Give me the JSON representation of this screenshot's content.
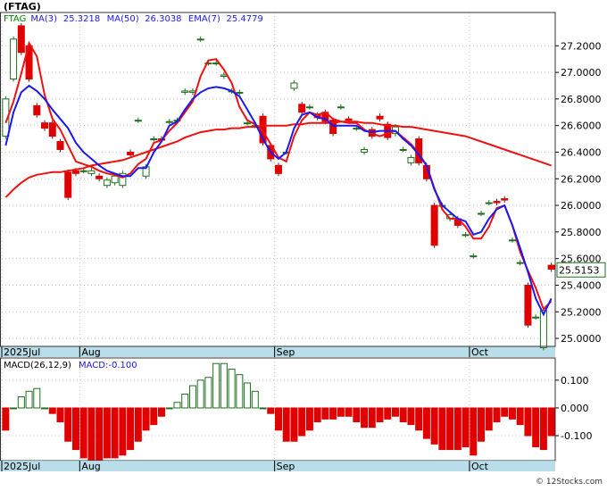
{
  "title": "(FTAG)",
  "watermark": "© 12Stocks.com",
  "colors": {
    "up": "#1f6f1f",
    "down": "#e00000",
    "ma3": "#ee1111",
    "ma50": "#ee1111",
    "ema7": "#1a1aee",
    "ma_fast": "#1a1aee",
    "price_box": "#1f6f1f",
    "frame": "#333333"
  },
  "chart_data": [
    {
      "type": "candlestick",
      "legend": [
        {
          "text": "FTAG",
          "color": "#008000"
        },
        {
          "text": "MA(3)",
          "color": "#1a1aee"
        },
        {
          "text": "25.3218",
          "color": "#1a1aee"
        },
        {
          "text": "MA(50)",
          "color": "#1a1aee"
        },
        {
          "text": "26.3038",
          "color": "#1a1aee"
        },
        {
          "text": "EMA(7)",
          "color": "#1a1aee"
        },
        {
          "text": "25.4779",
          "color": "#1a1aee"
        }
      ],
      "last_price": "25.5153",
      "ylim": [
        24.94,
        27.45
      ],
      "y_ticks": [
        "25.0000",
        "25.2000",
        "25.4000",
        "25.6000",
        "25.8000",
        "26.0000",
        "26.2000",
        "26.4000",
        "26.6000",
        "26.8000",
        "27.0000",
        "27.2000"
      ],
      "x_labels": [
        {
          "label": "2025Jul",
          "index": 0
        },
        {
          "label": "Aug",
          "index": 10
        },
        {
          "label": "Sep",
          "index": 35
        },
        {
          "label": "Oct",
          "index": 60
        }
      ],
      "grid": true,
      "candles": [
        [
          26.52,
          26.8
        ],
        [
          26.95,
          27.25
        ],
        [
          27.35,
          27.15
        ],
        [
          27.2,
          26.95
        ],
        [
          26.75,
          26.68
        ],
        [
          26.62,
          26.58
        ],
        [
          26.62,
          26.52
        ],
        [
          26.48,
          26.42
        ],
        [
          26.25,
          26.06
        ],
        [
          26.26,
          26.24
        ],
        [
          26.26,
          26.26
        ],
        [
          26.24,
          26.26
        ],
        [
          26.22,
          26.2
        ],
        [
          26.15,
          26.19
        ],
        [
          26.17,
          26.22
        ],
        [
          26.15,
          26.24
        ],
        [
          26.4,
          26.38
        ],
        [
          26.64,
          26.64
        ],
        [
          26.22,
          26.29
        ],
        [
          26.5,
          26.5
        ],
        [
          26.5,
          26.49
        ],
        [
          26.63,
          26.63
        ],
        [
          26.64,
          26.64
        ],
        [
          26.85,
          26.86
        ],
        [
          26.85,
          26.86
        ],
        [
          27.25,
          27.25
        ],
        [
          27.07,
          27.07
        ],
        [
          27.07,
          27.07
        ],
        [
          26.97,
          26.98
        ],
        [
          26.86,
          26.86
        ],
        [
          26.85,
          26.85
        ],
        [
          26.62,
          26.62
        ],
        [
          26.6,
          26.6
        ],
        [
          26.67,
          26.47
        ],
        [
          26.45,
          26.35
        ],
        [
          26.3,
          26.24
        ],
        [
          26.4,
          26.4
        ],
        [
          26.88,
          26.92
        ],
        [
          26.76,
          26.7
        ],
        [
          26.74,
          26.74
        ],
        [
          26.68,
          26.66
        ],
        [
          26.7,
          26.63
        ],
        [
          26.64,
          26.54
        ],
        [
          26.74,
          26.74
        ],
        [
          26.65,
          26.64
        ],
        [
          26.58,
          26.58
        ],
        [
          26.4,
          26.42
        ],
        [
          26.57,
          26.52
        ],
        [
          26.67,
          26.65
        ],
        [
          26.61,
          26.51
        ],
        [
          26.54,
          26.59
        ],
        [
          26.42,
          26.42
        ],
        [
          26.32,
          26.36
        ],
        [
          26.5,
          26.32
        ],
        [
          26.3,
          26.2
        ],
        [
          26.0,
          25.7
        ],
        [
          26.0,
          26.0
        ],
        [
          25.9,
          25.93
        ],
        [
          25.9,
          25.85
        ],
        [
          25.78,
          25.78
        ],
        [
          25.62,
          25.62
        ],
        [
          25.94,
          25.94
        ],
        [
          26.02,
          26.02
        ],
        [
          26.03,
          26.02
        ],
        [
          26.05,
          26.04
        ],
        [
          25.74,
          25.74
        ],
        [
          25.57,
          25.57
        ],
        [
          25.4,
          25.1
        ],
        [
          25.16,
          25.16
        ],
        [
          24.93,
          25.21
        ],
        [
          25.55,
          25.52
        ]
      ],
      "ma3": [
        26.62,
        26.78,
        26.99,
        27.22,
        27.12,
        26.83,
        26.65,
        26.57,
        26.45,
        26.33,
        26.31,
        26.29,
        26.26,
        26.24,
        26.23,
        26.21,
        26.24,
        26.31,
        26.35,
        26.47,
        26.49,
        26.56,
        26.62,
        26.7,
        26.78,
        26.97,
        27.09,
        27.1,
        27.02,
        26.92,
        26.74,
        26.64,
        26.61,
        26.56,
        26.46,
        26.36,
        26.33,
        26.52,
        26.64,
        26.7,
        26.68,
        26.7,
        26.65,
        26.63,
        26.62,
        26.62,
        26.57,
        26.54,
        26.52,
        26.54,
        26.56,
        26.51,
        26.46,
        26.39,
        26.3,
        26.13,
        25.97,
        25.9,
        25.9,
        25.84,
        25.75,
        25.75,
        25.84,
        25.98,
        26.0,
        25.85,
        25.65,
        25.51,
        25.38,
        25.22,
        25.28
      ],
      "ma50": [
        26.06,
        26.12,
        26.17,
        26.21,
        26.23,
        26.24,
        26.25,
        26.25,
        26.26,
        26.27,
        26.28,
        26.3,
        26.31,
        26.32,
        26.33,
        26.34,
        26.36,
        26.38,
        26.4,
        26.42,
        26.44,
        26.46,
        26.48,
        26.51,
        26.53,
        26.55,
        26.56,
        26.57,
        26.57,
        26.58,
        26.58,
        26.59,
        26.59,
        26.6,
        26.6,
        26.6,
        26.6,
        26.61,
        26.61,
        26.62,
        26.62,
        26.62,
        26.62,
        26.63,
        26.63,
        26.63,
        26.62,
        26.62,
        26.61,
        26.6,
        26.6,
        26.59,
        26.59,
        26.58,
        26.57,
        26.56,
        26.55,
        26.54,
        26.53,
        26.52,
        26.5,
        26.48,
        26.46,
        26.44,
        26.42,
        26.4,
        26.38,
        26.36,
        26.34,
        26.32,
        26.3
      ],
      "ema7": [
        26.45,
        26.7,
        26.85,
        26.9,
        26.86,
        26.8,
        26.72,
        26.65,
        26.58,
        26.47,
        26.4,
        26.35,
        26.3,
        26.26,
        26.24,
        26.22,
        26.22,
        26.28,
        26.28,
        26.4,
        26.48,
        26.6,
        26.63,
        26.72,
        26.8,
        26.85,
        26.88,
        26.89,
        26.88,
        26.86,
        26.82,
        26.72,
        26.62,
        26.5,
        26.4,
        26.35,
        26.4,
        26.58,
        26.68,
        26.7,
        26.66,
        26.65,
        26.6,
        26.6,
        26.6,
        26.6,
        26.56,
        26.55,
        26.56,
        26.56,
        26.56,
        26.5,
        26.45,
        26.38,
        26.3,
        26.12,
        26.0,
        25.95,
        25.9,
        25.88,
        25.78,
        25.8,
        25.9,
        25.97,
        26.0,
        25.85,
        25.68,
        25.5,
        25.3,
        25.18,
        25.3
      ]
    },
    {
      "type": "bar",
      "legend": [
        {
          "text": "MACD(26,12,9)",
          "color": "#000000"
        },
        {
          "text": "MACD:-0.100",
          "color": "#1a1aee"
        }
      ],
      "ylim": [
        -0.19,
        0.18
      ],
      "y_ticks": [
        "0.100",
        "0.000",
        "-0.100"
      ],
      "x_labels": [
        {
          "label": "2025Jul",
          "index": 0
        },
        {
          "label": "Aug",
          "index": 10
        },
        {
          "label": "Sep",
          "index": 35
        },
        {
          "label": "Oct",
          "index": 60
        }
      ],
      "values": [
        -0.08,
        0.0,
        0.04,
        0.06,
        0.07,
        0.0,
        -0.02,
        -0.05,
        -0.12,
        -0.15,
        -0.18,
        -0.19,
        -0.19,
        -0.18,
        -0.18,
        -0.17,
        -0.15,
        -0.12,
        -0.08,
        -0.06,
        -0.03,
        0.0,
        0.02,
        0.05,
        0.08,
        0.1,
        0.11,
        0.16,
        0.16,
        0.14,
        0.12,
        0.09,
        0.06,
        0.0,
        -0.02,
        -0.08,
        -0.12,
        -0.12,
        -0.1,
        -0.08,
        -0.05,
        -0.04,
        -0.04,
        -0.03,
        -0.03,
        -0.05,
        -0.07,
        -0.07,
        -0.05,
        -0.04,
        -0.03,
        -0.05,
        -0.06,
        -0.08,
        -0.11,
        -0.13,
        -0.15,
        -0.15,
        -0.15,
        -0.14,
        -0.17,
        -0.12,
        -0.08,
        -0.05,
        -0.03,
        -0.04,
        -0.06,
        -0.1,
        -0.14,
        -0.15,
        -0.1
      ]
    }
  ]
}
